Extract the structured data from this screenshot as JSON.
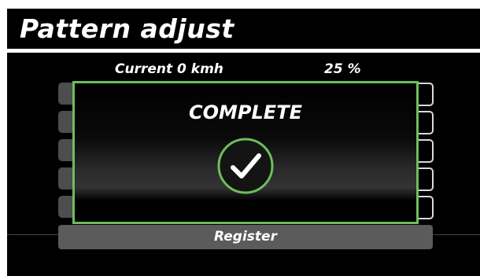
{
  "header": {
    "title": "Pattern adjust"
  },
  "status": {
    "current": "Current 0 kmh",
    "percent": "25 %"
  },
  "dialog": {
    "message": "COMPLETE",
    "icon": "check-circle-icon",
    "accent_color": "#6cbf5a"
  },
  "footer": {
    "register_label": "Register"
  }
}
